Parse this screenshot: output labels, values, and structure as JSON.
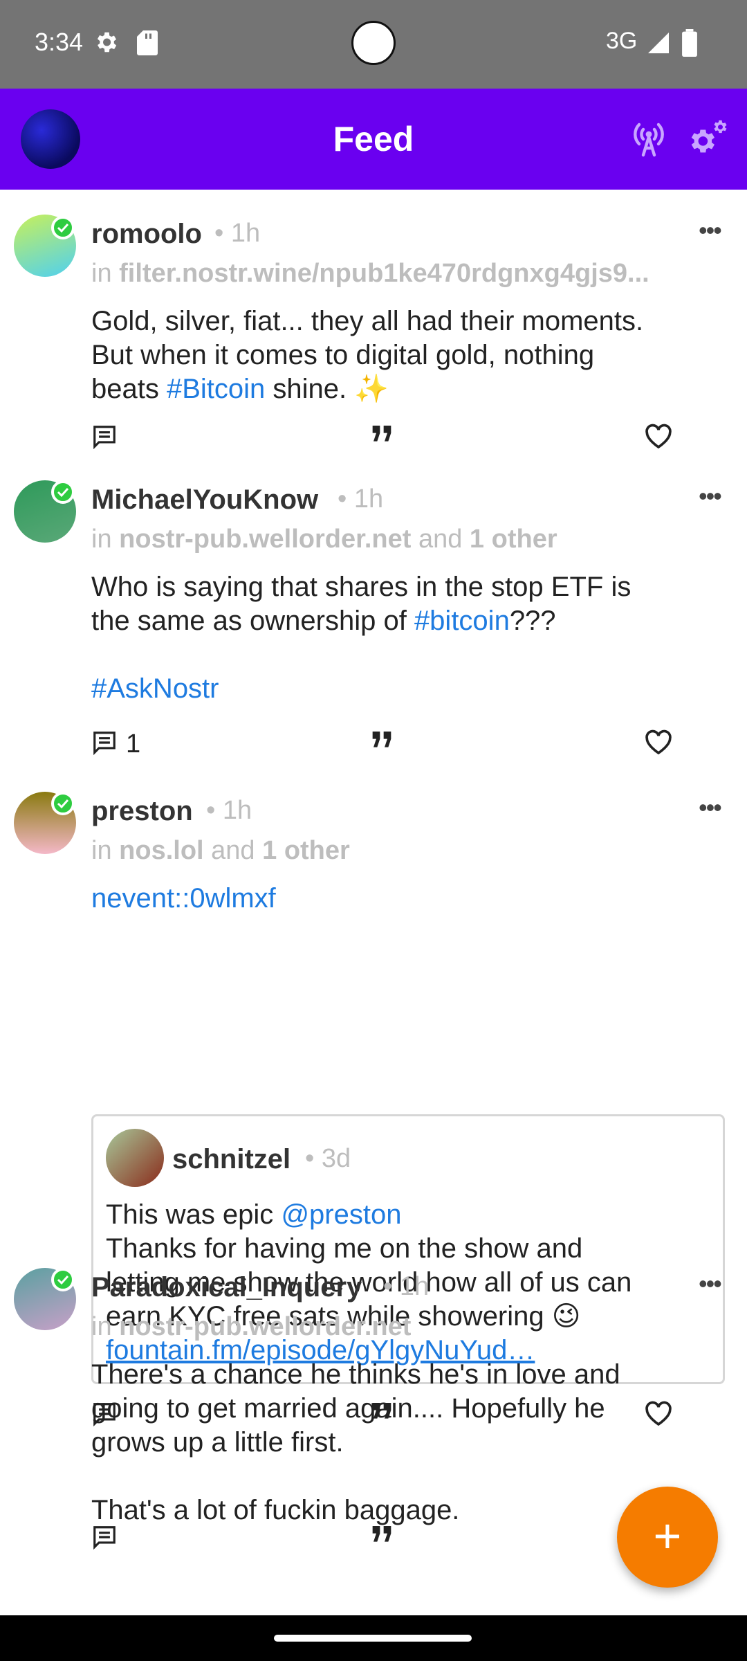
{
  "status_bar": {
    "time": "3:34",
    "network": "3G"
  },
  "app_bar": {
    "title": "Feed"
  },
  "posts": [
    {
      "author": "romoolo",
      "time": "1h",
      "relay_prefix": "in",
      "relay": "filter.nostr.wine/npub1ke470rdgnxg4gjs9...",
      "content_lines": [
        "Gold, silver, fiat... they all had their moments.",
        "But when it comes to digital gold, nothing",
        "beats"
      ],
      "hashtag": "#Bitcoin",
      "content_tail": "shine. ✨",
      "avatar_colors": [
        "#c8f05a",
        "#4fd0f0"
      ]
    },
    {
      "author": "MichaelYouKnow",
      "time": "1h",
      "relay_prefix": "in",
      "relay": "nostr-pub.wellorder.net",
      "relay_and": "and",
      "relay_other": "1 other",
      "content_lines": [
        "Who is saying that shares in the stop ETF is",
        "the same as ownership of"
      ],
      "hashtag": "#bitcoin",
      "content_tail": "???",
      "hashtag2": "#AskNostr",
      "reply_count": "1",
      "avatar_colors": [
        "#2e9a5a",
        "#5aa878"
      ]
    },
    {
      "author": "preston",
      "time": "1h",
      "relay_prefix": "in",
      "relay": "nos.lol",
      "relay_and": "and",
      "relay_other": "1 other",
      "event_link": "nevent::0wlmxf",
      "quote": {
        "author": "schnitzel",
        "time": "3d",
        "line1": "This was epic",
        "mention": "@preston",
        "lines": [
          "Thanks for having me on the show and",
          "letting me show the world how all of us can",
          "earn KYC free sats while showering 😉"
        ],
        "url": "fountain.fm/episode/gYlgyNuYud…"
      },
      "avatar_colors": [
        "#8a7a10",
        "#f4b8c8"
      ]
    },
    {
      "author": "Paradoxical_Inquery",
      "time": "1h",
      "relay_prefix": "in",
      "relay": "nostr-pub.wellorder.net",
      "content_lines": [
        "There's a chance he thinks he's in love and",
        "going to get married again.... Hopefully he",
        "grows up a little first."
      ],
      "content_para2": "That's a lot of fuckin baggage.",
      "avatar_colors": [
        "#5aa0a0",
        "#c8a0c8"
      ]
    }
  ],
  "partial_post": {
    "author": "preston",
    "time": "1h"
  },
  "fab_label": "+",
  "separator": "•",
  "more_label": "•••"
}
